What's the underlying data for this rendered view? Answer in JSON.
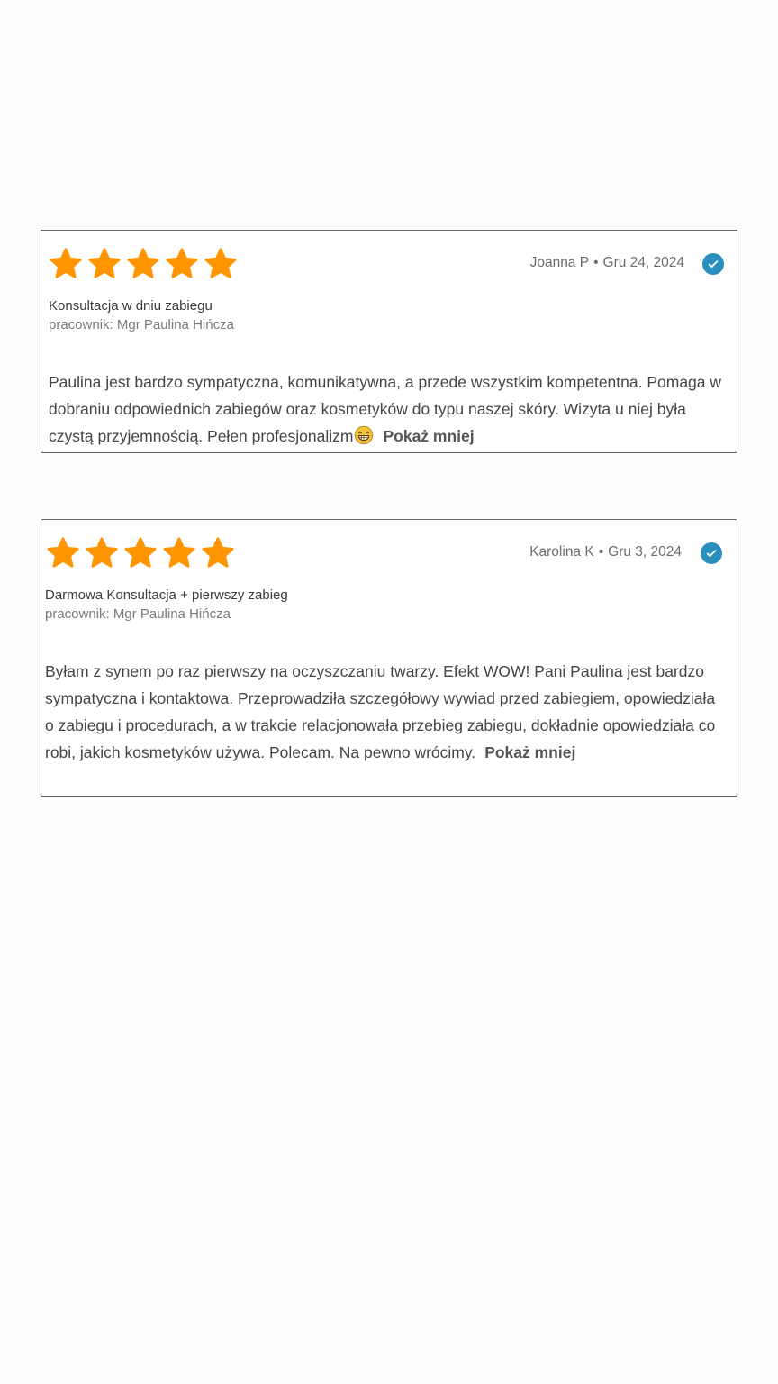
{
  "reviews": [
    {
      "rating": 5,
      "author": "Joanna P",
      "date": "Gru 24, 2024",
      "verified": true,
      "service": "Konsultacja w dniu zabiegu",
      "employee": "pracownik: Mgr Paulina Hińcza",
      "text": "Paulina jest bardzo sympatyczna, komunikatywna, a przede wszystkim kompetentna. Pomaga w dobraniu odpowiednich zabiegów oraz kosmetyków do typu naszej skóry. Wizyta u niej była czystą przyjemnością. Pełen profesjonalizm",
      "emoji": "grinning-face-icon",
      "toggle_label": "Pokaż mniej"
    },
    {
      "rating": 5,
      "author": "Karolina K",
      "date": "Gru 3, 2024",
      "verified": true,
      "service": "Darmowa Konsultacja + pierwszy zabieg",
      "employee": "pracownik: Mgr Paulina Hińcza",
      "text": "Byłam z synem po raz pierwszy na oczyszczaniu twarzy. Efekt WOW! Pani Paulina jest bardzo sympatyczna i kontaktowa. Przeprowadziła szczegółowy wywiad przed zabiegiem, opowiedziała o zabiegu i procedurach, a w trakcie relacjonowała przebieg zabiegu, dokładnie opowiedziała co robi, jakich kosmetyków używa. Polecam. Na pewno wrócimy.",
      "toggle_label": "Pokaż mniej"
    }
  ],
  "colors": {
    "star": "#ff9500",
    "verified": "#2a8fbd",
    "border": "#6b6b6b"
  },
  "separator": "•"
}
